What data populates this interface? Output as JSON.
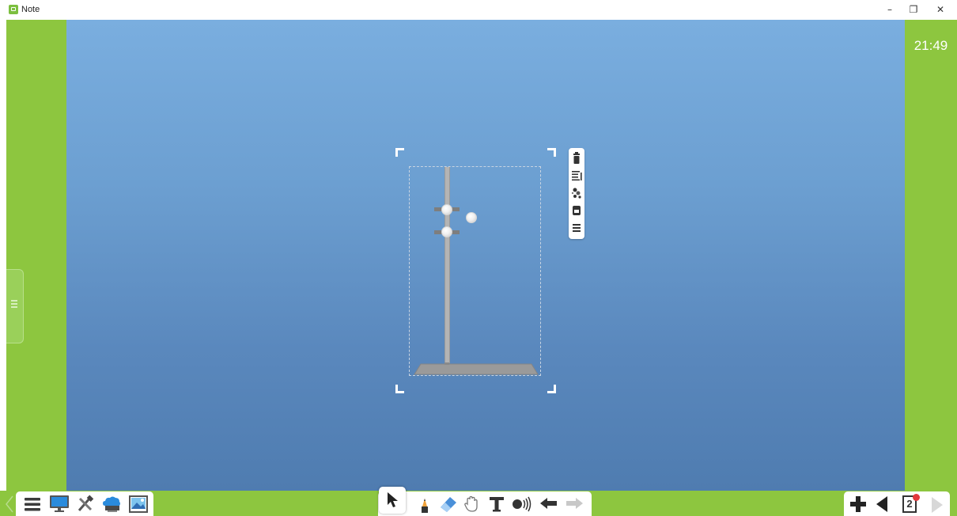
{
  "window": {
    "title": "Note",
    "controls": {
      "minimize": "–",
      "maximize": "❐",
      "close": "✕"
    }
  },
  "clock": {
    "time": "21:49"
  },
  "colors": {
    "frame_green": "#8dc63f",
    "canvas_top": "#7aaedf",
    "canvas_bottom": "#4f7cb0",
    "toolbar_bg": "#ffffff",
    "page_badge": "#e2383c"
  },
  "canvas": {
    "object": {
      "name": "iron-stand-with-clamps",
      "parts": [
        "stand-rod",
        "stand-base",
        "clamp-1",
        "clamp-2",
        "ball"
      ]
    },
    "object_toolbar": {
      "buttons": [
        "trash-icon",
        "align-icon",
        "effects-icon",
        "clone-icon",
        "menu-icon"
      ]
    }
  },
  "side_panel": {
    "icon": "collapse-tab-icon"
  },
  "bottom_toolbar": {
    "left": [
      "menu-icon",
      "board-icon",
      "tools-icon",
      "cloud-icon",
      "image-icon"
    ],
    "center": [
      "select-arrow-icon",
      "pen-icon",
      "eraser-icon",
      "hand-roam-icon",
      "text-icon",
      "sound-icon",
      "undo-icon",
      "redo-icon"
    ],
    "right": [
      "add-page-icon",
      "previous-page-icon",
      "page-thumbnail-icon",
      "next-page-icon"
    ],
    "page": {
      "number": "2"
    }
  }
}
